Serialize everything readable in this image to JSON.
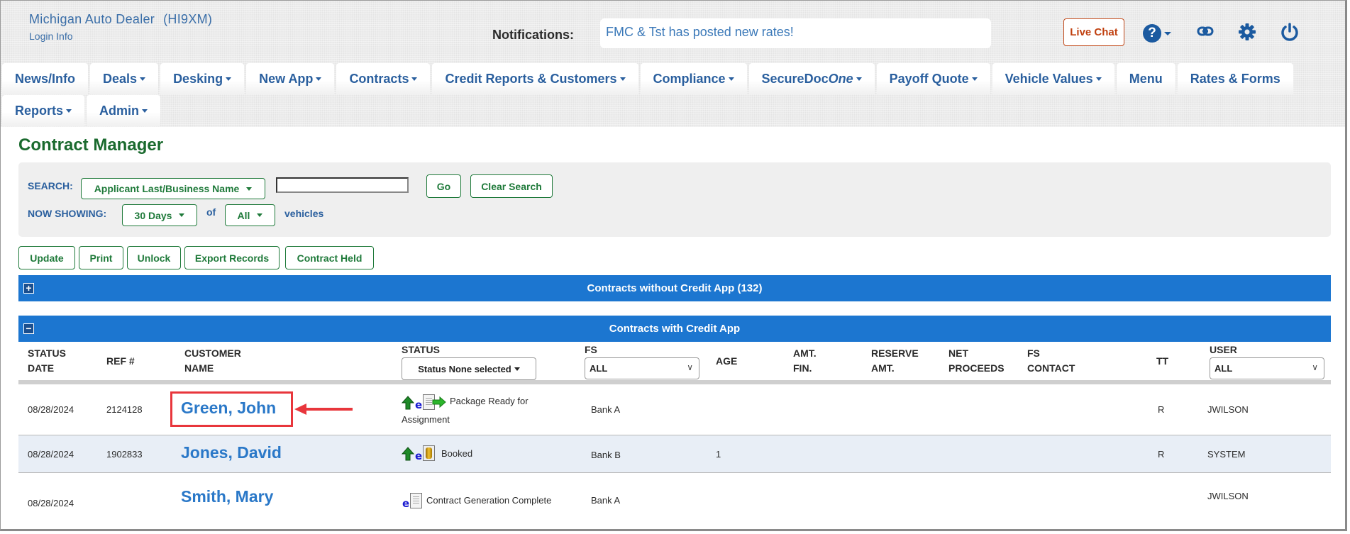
{
  "header": {
    "dealer_name": "Michigan Auto Dealer",
    "dealer_code": "(HI9XM)",
    "login_info": "Login Info",
    "notifications_label": "Notifications:",
    "notification_text": "FMC & Tst has posted new rates!",
    "live_chat": "Live Chat",
    "help_glyph": "?",
    "icons": [
      "help-icon",
      "link-icon",
      "gear-icon",
      "power-icon"
    ]
  },
  "nav": {
    "row1": [
      {
        "label": "News/Info",
        "dropdown": false
      },
      {
        "label": "Deals",
        "dropdown": true
      },
      {
        "label": "Desking",
        "dropdown": true
      },
      {
        "label": "New App",
        "dropdown": true
      },
      {
        "label": "Contracts",
        "dropdown": true
      },
      {
        "label": "Credit Reports & Customers",
        "dropdown": true
      },
      {
        "label": "Compliance",
        "dropdown": true
      },
      {
        "label": "SecureDoc",
        "label_italic": "One",
        "dropdown": true
      },
      {
        "label": "Payoff Quote",
        "dropdown": true
      },
      {
        "label": "Vehicle Values",
        "dropdown": true
      },
      {
        "label": "Menu",
        "dropdown": false
      },
      {
        "label": "Rates & Forms",
        "dropdown": false
      }
    ],
    "row2": [
      {
        "label": "Reports",
        "dropdown": true
      },
      {
        "label": "Admin",
        "dropdown": true
      }
    ]
  },
  "page": {
    "title": "Contract Manager"
  },
  "search": {
    "search_label": "SEARCH:",
    "search_by": "Applicant Last/Business Name",
    "search_value": "",
    "go": "Go",
    "clear": "Clear Search",
    "now_showing_label": "NOW SHOWING:",
    "days": "30 Days",
    "of": "of",
    "vehicles_filter": "All",
    "vehicles_label": "vehicles"
  },
  "actions": {
    "update": "Update",
    "print": "Print",
    "unlock": "Unlock",
    "export": "Export Records",
    "held": "Contract Held"
  },
  "sections": {
    "without_credit": {
      "title": "Contracts without Credit App (132)",
      "toggle": "+",
      "expanded": false
    },
    "with_credit": {
      "title": "Contracts with Credit App",
      "toggle": "−",
      "expanded": true
    }
  },
  "table": {
    "headers": {
      "status_date_1": "STATUS",
      "status_date_2": "DATE",
      "ref": "REF #",
      "customer_1": "CUSTOMER",
      "customer_2": "NAME",
      "status": "STATUS",
      "status_filter": "Status None selected",
      "fs": "FS",
      "fs_filter": "ALL",
      "age": "AGE",
      "amt_fin_1": "AMT.",
      "amt_fin_2": "FIN.",
      "reserve_1": "RESERVE",
      "reserve_2": "AMT.",
      "net_1": "NET",
      "net_2": "PROCEEDS",
      "fs_contact_1": "FS",
      "fs_contact_2": "CONTACT",
      "tt": "TT",
      "user": "USER",
      "user_filter": "ALL"
    },
    "rows": [
      {
        "status_date": "08/28/2024",
        "ref": "2124128",
        "customer": "Green, John",
        "status_icons": [
          "up-arrow-icon",
          "e-contract-icon",
          "document-icon",
          "send-arrow-icon"
        ],
        "status_1": "Package Ready for",
        "status_2": "Assignment",
        "fs": "Bank A",
        "age": "",
        "amt_fin": "",
        "reserve": "",
        "net": "",
        "fs_contact": "",
        "tt": "R",
        "user": "JWILSON",
        "highlighted": true
      },
      {
        "status_date": "08/28/2024",
        "ref": "1902833",
        "customer": "Jones, David",
        "status_icons": [
          "up-arrow-icon",
          "e-contract-icon",
          "coin-icon"
        ],
        "status_1": "Booked",
        "status_2": "",
        "fs": "Bank B",
        "age": "1",
        "amt_fin": "",
        "reserve": "",
        "net": "",
        "fs_contact": "",
        "tt": "R",
        "user": "SYSTEM",
        "highlighted": false
      },
      {
        "status_date": "08/28/2024",
        "ref": "",
        "customer": "Smith, Mary",
        "status_icons": [
          "e-contract-icon",
          "document-icon"
        ],
        "status_1": "Contract Generation Complete",
        "status_2": "",
        "fs": "Bank A",
        "age": "",
        "amt_fin": "",
        "reserve": "",
        "net": "",
        "fs_contact": "",
        "tt": "",
        "user": "JWILSON",
        "highlighted": false
      }
    ]
  },
  "colors": {
    "brand_blue": "#2a5f9e",
    "section_bar": "#1c76d0",
    "brand_green": "#1f7a3a",
    "customer_link": "#2a78c8",
    "annotation_red": "#e8363c",
    "live_chat": "#c0400f"
  }
}
